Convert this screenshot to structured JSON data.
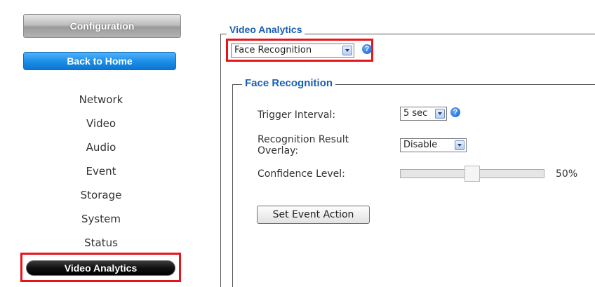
{
  "sidebar": {
    "header": "Configuration",
    "home_button": "Back to Home",
    "items": [
      {
        "label": "Network"
      },
      {
        "label": "Video"
      },
      {
        "label": "Audio"
      },
      {
        "label": "Event"
      },
      {
        "label": "Storage"
      },
      {
        "label": "System"
      },
      {
        "label": "Status"
      },
      {
        "label": "Video Analytics",
        "active": true
      }
    ]
  },
  "main": {
    "section_title": "Video Analytics",
    "analytics_select": {
      "value": "Face Recognition"
    },
    "help_icon": "?",
    "subsection_title": "Face Recognition",
    "fields": {
      "trigger_interval": {
        "label": "Trigger Interval:",
        "value": "5 sec"
      },
      "overlay": {
        "label_line1": "Recognition Result",
        "label_line2": "Overlay:",
        "value": "Disable"
      },
      "confidence": {
        "label": "Confidence Level:",
        "value_text": "50%",
        "fraction": 0.5
      }
    },
    "set_event_button": "Set Event Action"
  },
  "colors": {
    "title_blue": "#1a5fb4",
    "highlight_red": "#e8141b",
    "home_blue": "#1e8fe8"
  }
}
